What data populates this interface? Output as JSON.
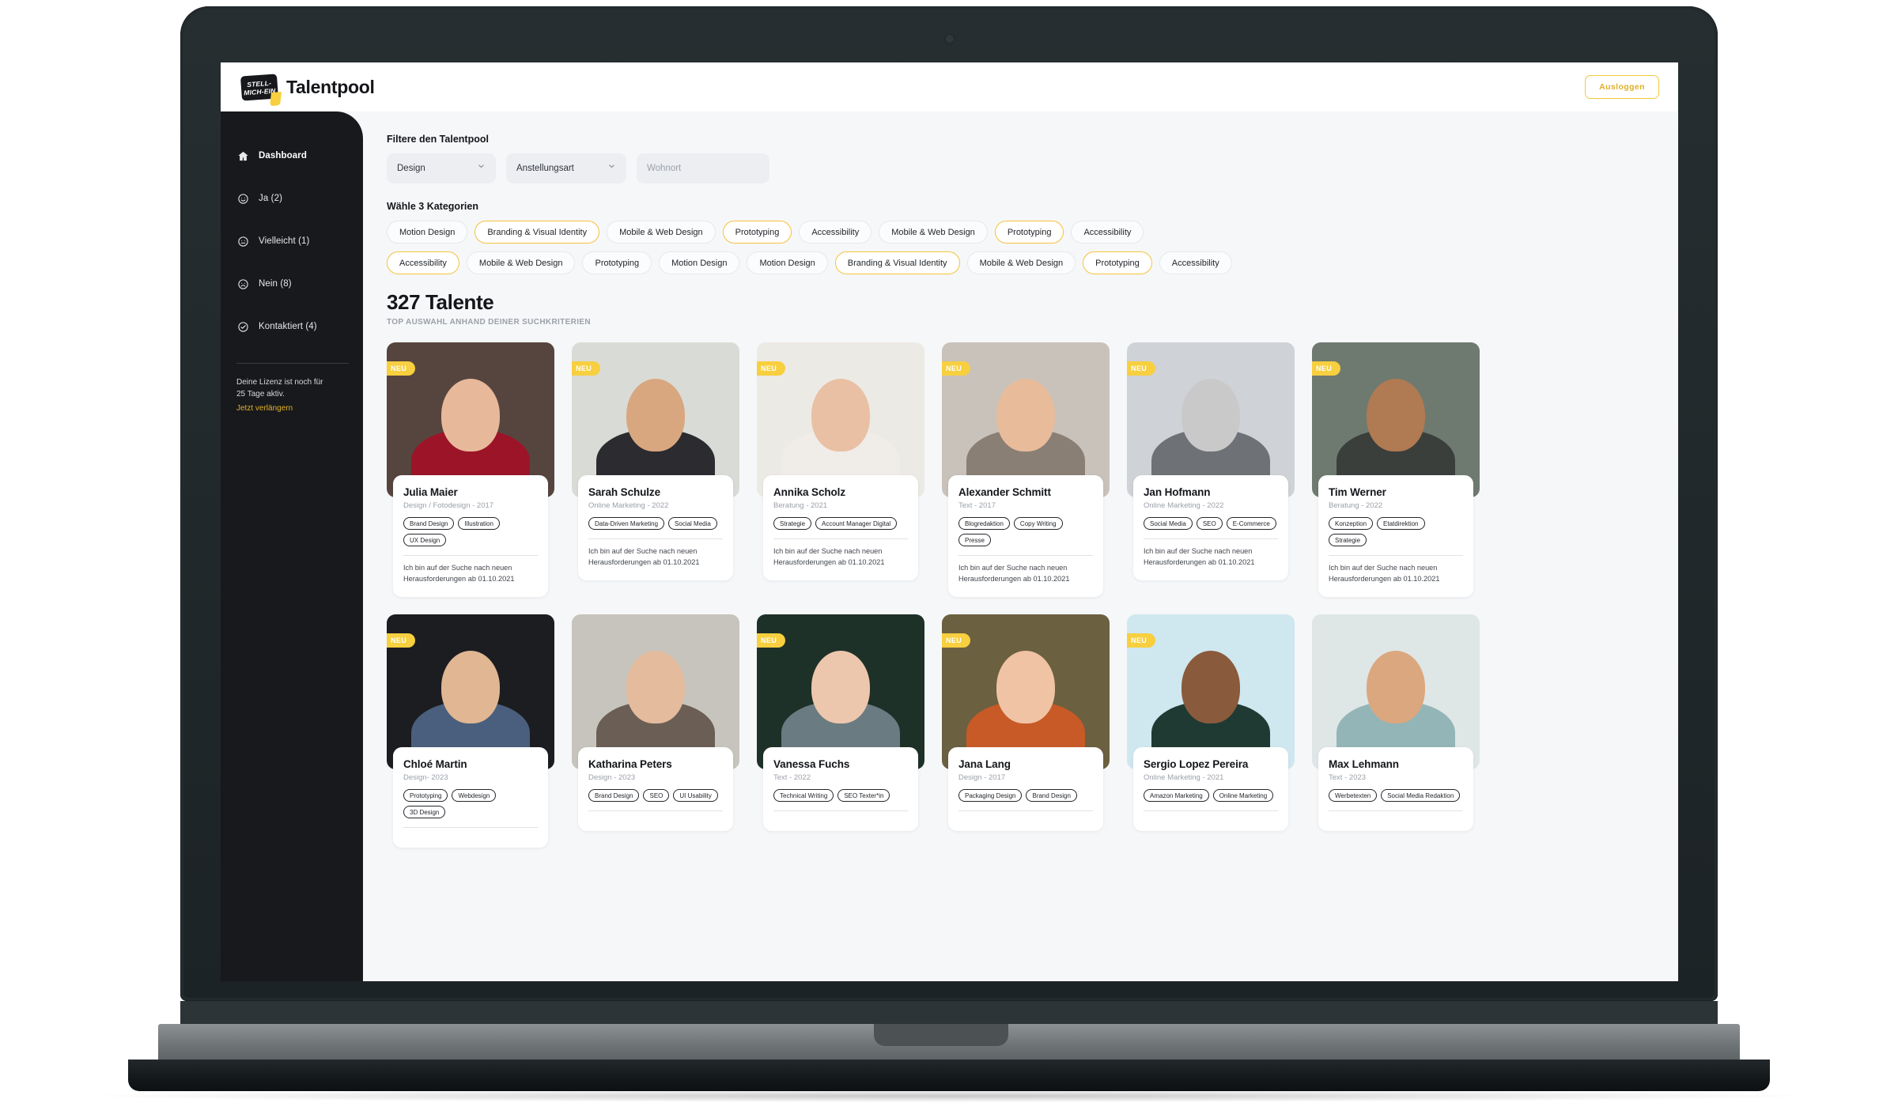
{
  "header": {
    "logo_line1": "STELL-",
    "logo_line2": "MICH-EIN",
    "title": "Talentpool",
    "logout_label": "Ausloggen"
  },
  "sidebar": {
    "items": [
      {
        "label": "Dashboard",
        "icon": "home-icon",
        "active": true
      },
      {
        "label": "Ja (2)",
        "icon": "smiley-happy-icon",
        "active": false
      },
      {
        "label": "Vielleicht (1)",
        "icon": "smiley-neutral-icon",
        "active": false
      },
      {
        "label": "Nein (8)",
        "icon": "smiley-sad-icon",
        "active": false
      },
      {
        "label": "Kontaktiert (4)",
        "icon": "check-circle-icon",
        "active": false
      }
    ],
    "license_line1": "Deine Lizenz ist noch für",
    "license_line2": "25 Tage aktiv.",
    "license_link": "Jetzt verlängern"
  },
  "filters": {
    "heading": "Filtere den Talentpool",
    "category_select": "Design",
    "employment_select": "Anstellungsart",
    "location_placeholder": "Wohnort",
    "location_value": "",
    "categories_heading": "Wähle 3 Kategorien",
    "chips_row1": [
      {
        "label": "Motion Design",
        "selected": false
      },
      {
        "label": "Branding & Visual Identity",
        "selected": true
      },
      {
        "label": "Mobile & Web Design",
        "selected": false
      },
      {
        "label": "Prototyping",
        "selected": true
      },
      {
        "label": "Accessibility",
        "selected": false
      },
      {
        "label": "Mobile & Web Design",
        "selected": false
      },
      {
        "label": "Prototyping",
        "selected": true
      },
      {
        "label": "Accessibility",
        "selected": false
      }
    ],
    "chips_row2": [
      {
        "label": "Accessibility",
        "selected": true
      },
      {
        "label": "Mobile & Web Design",
        "selected": false
      },
      {
        "label": "Prototyping",
        "selected": false
      },
      {
        "label": "Motion Design",
        "selected": false
      },
      {
        "label": "Motion Design",
        "selected": false
      },
      {
        "label": "Branding & Visual Identity",
        "selected": true
      },
      {
        "label": "Mobile & Web Design",
        "selected": false
      },
      {
        "label": "Prototyping",
        "selected": true
      },
      {
        "label": "Accessibility",
        "selected": false
      }
    ]
  },
  "results": {
    "count_label": "327 Talente",
    "subtitle": "TOP AUSWAHL ANHAND DEINER SUCHKRITERIEN",
    "badge_new_label": "NEU"
  },
  "talents": [
    {
      "name": "Julia Maier",
      "meta": "Design / Fotodesign - 2017",
      "tags": [
        "Brand Design",
        "Illustration",
        "UX Design"
      ],
      "note": "Ich bin auf der Suche nach neuen Herausforderungen ab 01.10.2021",
      "is_new": true,
      "photo_bg": "#56453f",
      "photo_skin": "#e8b89a",
      "photo_cloth": "#9c1428"
    },
    {
      "name": "Sarah Schulze",
      "meta": "Online Marketing - 2022",
      "tags": [
        "Data-Driven Marketing",
        "Social Media"
      ],
      "note": "Ich bin auf der Suche nach neuen Herausforderungen ab 01.10.2021",
      "is_new": true,
      "photo_bg": "#d9dcd6",
      "photo_skin": "#d8a780",
      "photo_cloth": "#2b2b30"
    },
    {
      "name": "Annika Scholz",
      "meta": "Beratung - 2021",
      "tags": [
        "Strategie",
        "Account Manager Digital"
      ],
      "note": "Ich bin auf der Suche nach neuen Herausforderungen ab 01.10.2021",
      "is_new": true,
      "photo_bg": "#eceae5",
      "photo_skin": "#e9c0a4",
      "photo_cloth": "#f0ece8"
    },
    {
      "name": "Alexander Schmitt",
      "meta": "Text - 2017",
      "tags": [
        "Blogredaktion",
        "Copy Writing",
        "Presse"
      ],
      "note": "Ich bin auf der Suche nach neuen Herausforderungen ab 01.10.2021",
      "is_new": true,
      "photo_bg": "#c8c2bb",
      "photo_skin": "#e8bb9b",
      "photo_cloth": "#8a7f74"
    },
    {
      "name": "Jan Hofmann",
      "meta": "Online Marketing - 2022",
      "tags": [
        "Social Media",
        "SEO",
        "E-Commerce"
      ],
      "note": "Ich bin auf der Suche nach neuen Herausforderungen ab 01.10.2021",
      "is_new": true,
      "photo_bg": "#cfd2d6",
      "photo_skin": "#c9c9c9",
      "photo_cloth": "#6e7276"
    },
    {
      "name": "Tim Werner",
      "meta": "Beratung - 2022",
      "tags": [
        "Konzeption",
        "Etatdirektion",
        "Strategie"
      ],
      "note": "Ich bin auf der Suche nach neuen Herausforderungen ab 01.10.2021",
      "is_new": true,
      "photo_bg": "#6e7a70",
      "photo_skin": "#b07a52",
      "photo_cloth": "#3a3f3c"
    },
    {
      "name": "Chloé Martin",
      "meta": "Design- 2023",
      "tags": [
        "Prototyping",
        "Webdesign",
        "3D Design"
      ],
      "note": "",
      "is_new": true,
      "photo_bg": "#1c1d21",
      "photo_skin": "#e0b693",
      "photo_cloth": "#4a5f7d"
    },
    {
      "name": "Katharina Peters",
      "meta": "Design - 2023",
      "tags": [
        "Brand Design",
        "SEO",
        "UI Usability"
      ],
      "note": "",
      "is_new": false,
      "photo_bg": "#c7c4bd",
      "photo_skin": "#e4bb9d",
      "photo_cloth": "#6b5f55"
    },
    {
      "name": "Vanessa Fuchs",
      "meta": "Text - 2022",
      "tags": [
        "Technical Writing",
        "SEO Texter*in"
      ],
      "note": "",
      "is_new": true,
      "photo_bg": "#1e3128",
      "photo_skin": "#ecc7ad",
      "photo_cloth": "#6b7b82"
    },
    {
      "name": "Jana Lang",
      "meta": "Design - 2017",
      "tags": [
        "Packaging Design",
        "Brand Design"
      ],
      "note": "",
      "is_new": true,
      "photo_bg": "#6b6040",
      "photo_skin": "#f0c3a4",
      "photo_cloth": "#c75a26"
    },
    {
      "name": "Sergio Lopez Pereira",
      "meta": "Online Marketing - 2021",
      "tags": [
        "Amazon Marketing",
        "Online Marketing"
      ],
      "note": "",
      "is_new": true,
      "photo_bg": "#cfe7ef",
      "photo_skin": "#8a5a3c",
      "photo_cloth": "#1e3a33"
    },
    {
      "name": "Max Lehmann",
      "meta": "Text - 2023",
      "tags": [
        "Werbetexten",
        "Social Media Redaktion"
      ],
      "note": "",
      "is_new": false,
      "photo_bg": "#dfe6e6",
      "photo_skin": "#dba77e",
      "photo_cloth": "#94b5b8"
    }
  ],
  "colors": {
    "accent_yellow": "#f3c33f",
    "sidebar_dark": "#17191c",
    "page_bg": "#f6f7f9"
  }
}
